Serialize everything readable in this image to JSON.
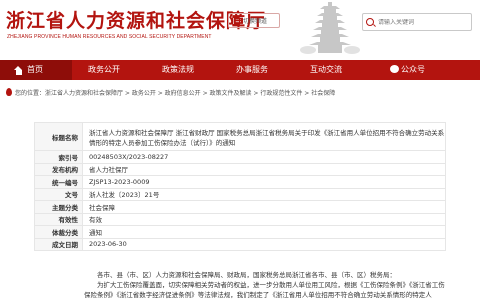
{
  "header": {
    "logo_cn": "浙江省人力资源和社会保障厅",
    "logo_en": "ZHEJIANG PROVINCE HUMAN RESOURCES AND SOCIAL SECURITY DEPARTMENT",
    "switch_label": "切换频道",
    "search_placeholder": "请输入关键词"
  },
  "nav": {
    "items": [
      "首页",
      "政务公开",
      "政策法规",
      "办事服务",
      "互动交流",
      "公众号"
    ]
  },
  "breadcrumb": {
    "text": "您的位置：浙江省人力资源和社会保障厅 > 政务公开 > 政府信息公开 > 政策文件及解读 > 行政规范性文件 > 社会保障"
  },
  "info": {
    "rows": [
      {
        "label": "标题名称",
        "value": "浙江省人力资源和社会保障厅 浙江省财政厅 国家税务总局浙江省税务局关于印发《浙江省用人单位招用不符合确立劳动关系情形的特定人员参加工伤保险办法（试行）》的通知"
      },
      {
        "label": "索引号",
        "value": "002485​03X/2023-08227"
      },
      {
        "label": "发布机构",
        "value": "省人力社保厅"
      },
      {
        "label": "统一编号",
        "value": "ZJSP13-2023-0009"
      },
      {
        "label": "文号",
        "value": "浙人社发〔2023〕21号"
      },
      {
        "label": "主题分类",
        "value": "社会保障"
      },
      {
        "label": "有效性",
        "value": "有效"
      },
      {
        "label": "体裁分类",
        "value": "通知"
      },
      {
        "label": "成文日期",
        "value": "2023-06-30"
      }
    ]
  },
  "body": {
    "salutation": "各市、县（市、区）人力资源和社会保障局、财政局，国家税务总局浙江省各市、县（市、区）税务局：",
    "paragraph": "为扩大工伤保险覆盖面，切实保障相关劳动者的权益，进一步分散用人单位用工风险，根据《工伤保险条例》《浙江省工伤保险条例》《浙江省数字经济促进条例》等法律法规，我们制定了《浙江省用人单位招用不符合确立劳动关系情形的特定人"
  },
  "colors": {
    "brand_red": "#b3140f",
    "nav_dark": "#8e0d09"
  }
}
